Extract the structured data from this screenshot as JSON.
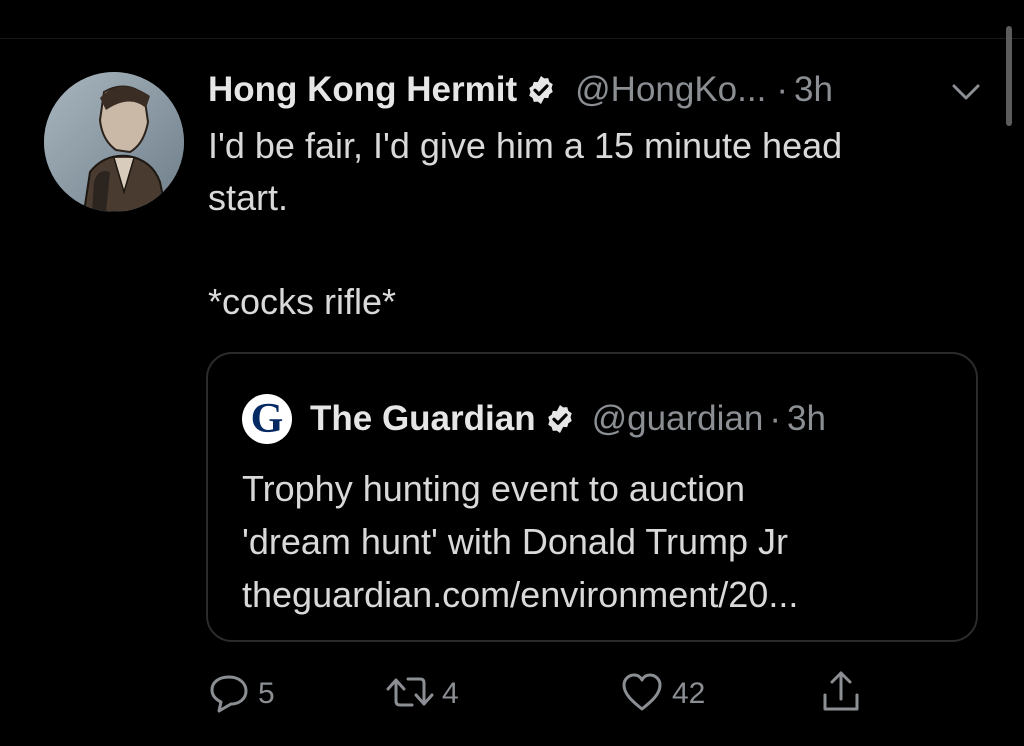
{
  "tweet": {
    "author": {
      "display_name": "Hong Kong Hermit",
      "handle": "@HongKo...",
      "verified": true
    },
    "separator": "·",
    "time": "3h",
    "text": "I'd be fair, I'd give him a 15 minute head\nstart.\n\n*cocks rifle*"
  },
  "quoted_tweet": {
    "logo_letter": "G",
    "display_name": "The Guardian",
    "handle": "@guardian",
    "separator": "·",
    "time": "3h",
    "verified": true,
    "lines": [
      "Trophy hunting event to auction",
      "'dream hunt' with Donald Trump Jr",
      "theguardian.com/environment/20..."
    ]
  },
  "actions": {
    "reply_count": "5",
    "retweet_count": "4",
    "like_count": "42"
  },
  "icons": {
    "verified": "verified-badge-icon",
    "more": "chevron-down-icon",
    "reply": "reply-icon",
    "retweet": "retweet-icon",
    "like": "heart-icon",
    "share": "share-icon"
  },
  "colors": {
    "background": "#000000",
    "primary_text": "#d9d9d9",
    "secondary_text": "#8b8f93",
    "border": "#2b2b2b",
    "guardian_blue": "#052962"
  }
}
